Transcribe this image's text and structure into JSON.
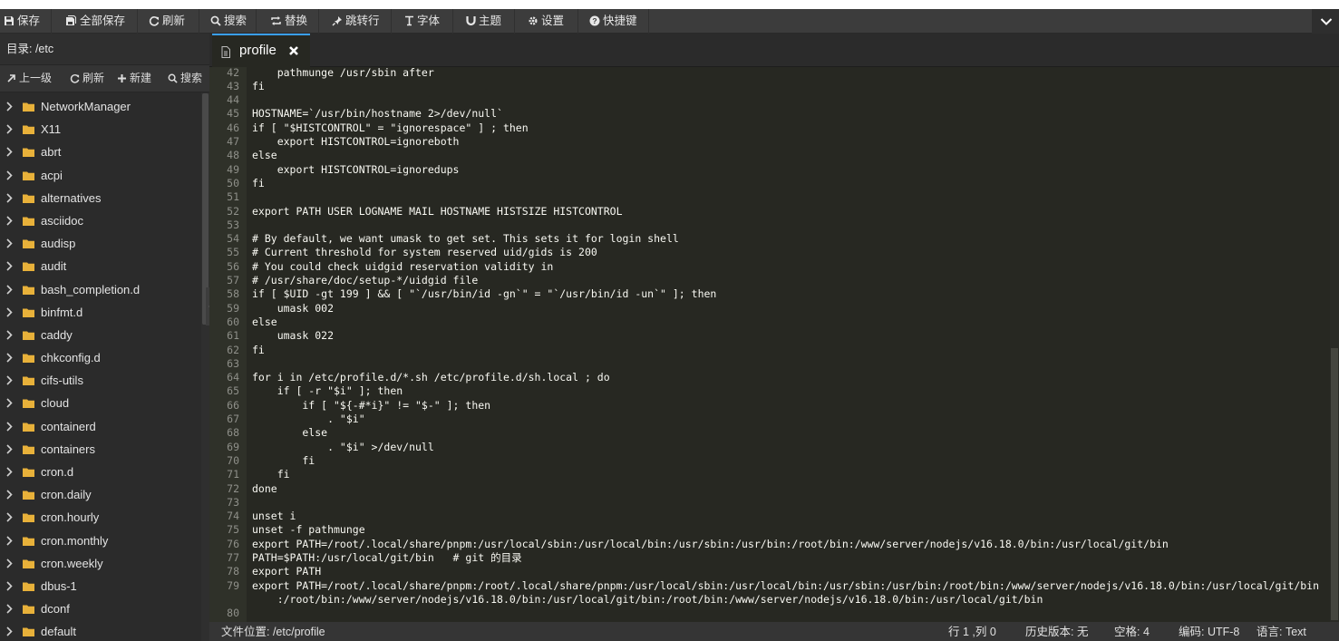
{
  "toolbar": {
    "buttons": [
      {
        "label": "保存",
        "icon": "floppy-icon"
      },
      {
        "label": "全部保存",
        "icon": "floppy-multi-icon"
      },
      {
        "label": "刷新",
        "icon": "refresh-icon"
      },
      {
        "label": "搜索",
        "icon": "search-icon"
      },
      {
        "label": "替换",
        "icon": "replace-icon"
      },
      {
        "label": "跳转行",
        "icon": "pin-icon"
      },
      {
        "label": "字体",
        "icon": "text-cursor-icon"
      },
      {
        "label": "主题",
        "icon": "magnet-icon"
      },
      {
        "label": "设置",
        "icon": "gear-icon"
      },
      {
        "label": "快捷键",
        "icon": "question-circle-icon"
      }
    ],
    "collapse_icon": "chevron-down-icon"
  },
  "sidebar": {
    "dir_label": "目录: /etc",
    "actions": [
      {
        "label": "上一级",
        "icon": "arrow-up-icon"
      },
      {
        "label": "刷新",
        "icon": "refresh-icon"
      },
      {
        "label": "新建",
        "icon": "plus-icon"
      },
      {
        "label": "搜索",
        "icon": "search-icon"
      }
    ],
    "folders": [
      "NetworkManager",
      "X11",
      "abrt",
      "acpi",
      "alternatives",
      "asciidoc",
      "audisp",
      "audit",
      "bash_completion.d",
      "binfmt.d",
      "caddy",
      "chkconfig.d",
      "cifs-utils",
      "cloud",
      "containerd",
      "containers",
      "cron.d",
      "cron.daily",
      "cron.hourly",
      "cron.monthly",
      "cron.weekly",
      "dbus-1",
      "dconf",
      "default"
    ]
  },
  "tab": {
    "name": "profile"
  },
  "editor": {
    "lines": [
      {
        "n": "42",
        "t": "    pathmunge /usr/sbin after"
      },
      {
        "n": "43",
        "t": "fi"
      },
      {
        "n": "44",
        "t": ""
      },
      {
        "n": "45",
        "t": "HOSTNAME=`/usr/bin/hostname 2>/dev/null`"
      },
      {
        "n": "46",
        "t": "if [ \"$HISTCONTROL\" = \"ignorespace\" ] ; then"
      },
      {
        "n": "47",
        "t": "    export HISTCONTROL=ignoreboth"
      },
      {
        "n": "48",
        "t": "else"
      },
      {
        "n": "49",
        "t": "    export HISTCONTROL=ignoredups"
      },
      {
        "n": "50",
        "t": "fi"
      },
      {
        "n": "51",
        "t": ""
      },
      {
        "n": "52",
        "t": "export PATH USER LOGNAME MAIL HOSTNAME HISTSIZE HISTCONTROL"
      },
      {
        "n": "53",
        "t": ""
      },
      {
        "n": "54",
        "t": "# By default, we want umask to get set. This sets it for login shell"
      },
      {
        "n": "55",
        "t": "# Current threshold for system reserved uid/gids is 200"
      },
      {
        "n": "56",
        "t": "# You could check uidgid reservation validity in"
      },
      {
        "n": "57",
        "t": "# /usr/share/doc/setup-*/uidgid file"
      },
      {
        "n": "58",
        "t": "if [ $UID -gt 199 ] && [ \"`/usr/bin/id -gn`\" = \"`/usr/bin/id -un`\" ]; then"
      },
      {
        "n": "59",
        "t": "    umask 002"
      },
      {
        "n": "60",
        "t": "else"
      },
      {
        "n": "61",
        "t": "    umask 022"
      },
      {
        "n": "62",
        "t": "fi"
      },
      {
        "n": "63",
        "t": ""
      },
      {
        "n": "64",
        "t": "for i in /etc/profile.d/*.sh /etc/profile.d/sh.local ; do"
      },
      {
        "n": "65",
        "t": "    if [ -r \"$i\" ]; then"
      },
      {
        "n": "66",
        "t": "        if [ \"${-#*i}\" != \"$-\" ]; then"
      },
      {
        "n": "67",
        "t": "            . \"$i\""
      },
      {
        "n": "68",
        "t": "        else"
      },
      {
        "n": "69",
        "t": "            . \"$i\" >/dev/null"
      },
      {
        "n": "70",
        "t": "        fi"
      },
      {
        "n": "71",
        "t": "    fi"
      },
      {
        "n": "72",
        "t": "done"
      },
      {
        "n": "73",
        "t": ""
      },
      {
        "n": "74",
        "t": "unset i"
      },
      {
        "n": "75",
        "t": "unset -f pathmunge"
      },
      {
        "n": "76",
        "t": "export PATH=/root/.local/share/pnpm:/usr/local/sbin:/usr/local/bin:/usr/sbin:/usr/bin:/root/bin:/www/server/nodejs/v16.18.0/bin:/usr/local/git/bin"
      },
      {
        "n": "77",
        "t": "PATH=$PATH:/usr/local/git/bin   # git 的目录"
      },
      {
        "n": "78",
        "t": "export PATH"
      },
      {
        "n": "79",
        "t": "export PATH=/root/.local/share/pnpm:/root/.local/share/pnpm:/usr/local/sbin:/usr/local/bin:/usr/sbin:/usr/bin:/root/bin:/www/server/nodejs/v16.18.0/bin:/usr/local/git/bin"
      },
      {
        "n": "",
        "t": "    :/root/bin:/www/server/nodejs/v16.18.0/bin:/usr/local/git/bin:/root/bin:/www/server/nodejs/v16.18.0/bin:/usr/local/git/bin"
      },
      {
        "n": "80",
        "t": ""
      }
    ]
  },
  "status": {
    "file_location": "文件位置: /etc/profile",
    "cursor": "行 1 ,列 0",
    "history": "历史版本: 无",
    "indent": "空格: 4",
    "encoding": "编码: UTF-8",
    "language": "语言: Text"
  },
  "colors": {
    "accent": "#3a9ff7",
    "folder": "#e8b13a",
    "editor_bg": "#272822"
  }
}
